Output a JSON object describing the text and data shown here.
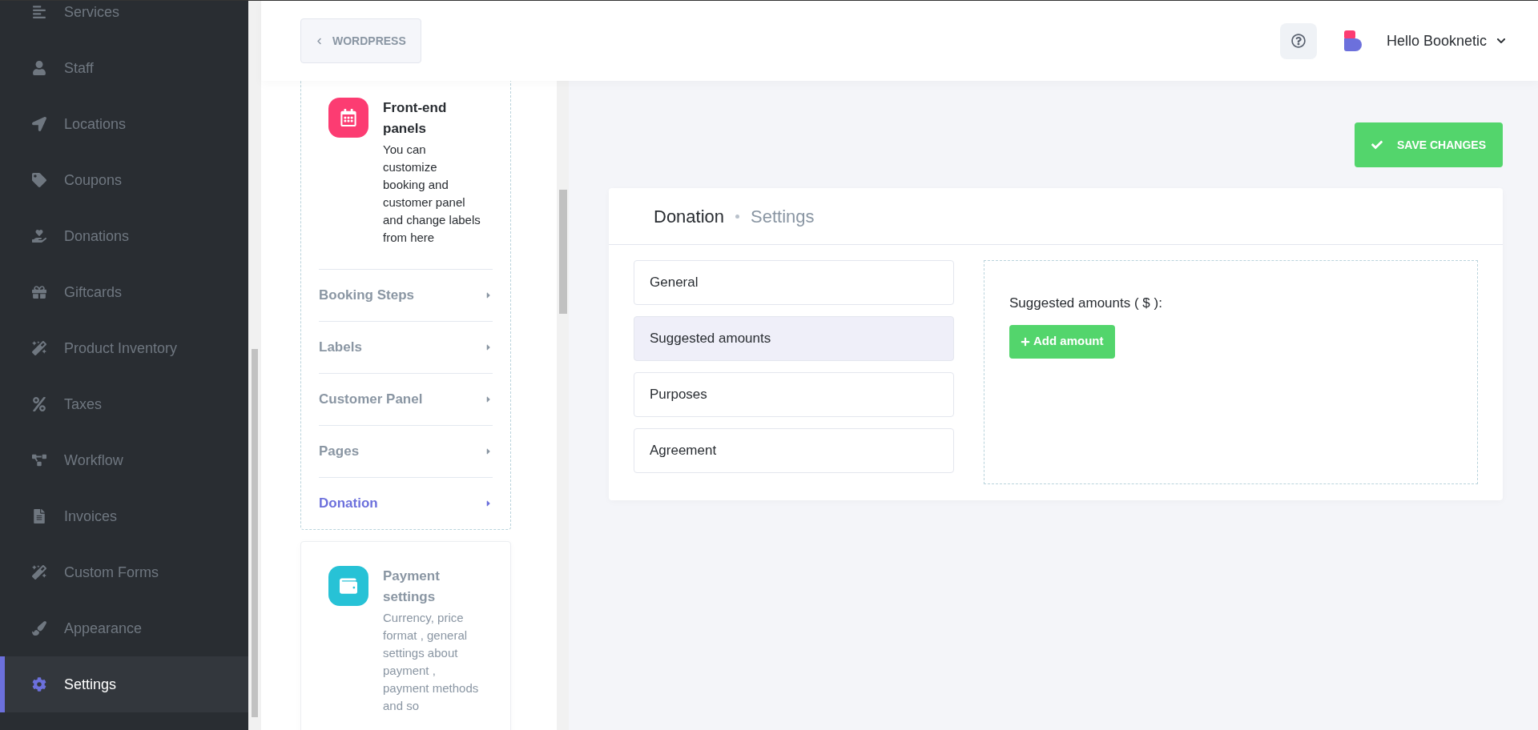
{
  "sidebar": {
    "items": [
      {
        "label": "Services",
        "selected": false
      },
      {
        "label": "Staff",
        "selected": false
      },
      {
        "label": "Locations",
        "selected": false
      },
      {
        "label": "Coupons",
        "selected": false
      },
      {
        "label": "Donations",
        "selected": false
      },
      {
        "label": "Giftcards",
        "selected": false
      },
      {
        "label": "Product Inventory",
        "selected": false
      },
      {
        "label": "Taxes",
        "selected": false
      },
      {
        "label": "Workflow",
        "selected": false
      },
      {
        "label": "Invoices",
        "selected": false
      },
      {
        "label": "Custom Forms",
        "selected": false
      },
      {
        "label": "Appearance",
        "selected": false
      },
      {
        "label": "Settings",
        "selected": true
      }
    ]
  },
  "header": {
    "back_button": "WORDPRESS",
    "user": "Hello Booknetic"
  },
  "settings_nav": {
    "cards": [
      {
        "title": "Front-end panels",
        "description": "You can customize booking and customer panel and change labels from here",
        "selected": true,
        "items": [
          {
            "label": "Booking Steps",
            "selected": false
          },
          {
            "label": "Labels",
            "selected": false
          },
          {
            "label": "Customer Panel",
            "selected": false
          },
          {
            "label": "Pages",
            "selected": false
          },
          {
            "label": "Donation",
            "selected": true
          }
        ]
      },
      {
        "title": "Payment settings",
        "description": "Currency, price format , general settings about payment , payment methods and so",
        "selected": false
      }
    ]
  },
  "save_button": "SAVE CHANGES",
  "panel": {
    "title": "Donation",
    "subtitle": "Settings",
    "tabs": [
      {
        "label": "General",
        "selected": false
      },
      {
        "label": "Suggested amounts",
        "selected": true
      },
      {
        "label": "Purposes",
        "selected": false
      },
      {
        "label": "Agreement",
        "selected": false
      }
    ],
    "content": {
      "label": "Suggested amounts ( $ ):",
      "add_button": "Add amount"
    }
  }
}
